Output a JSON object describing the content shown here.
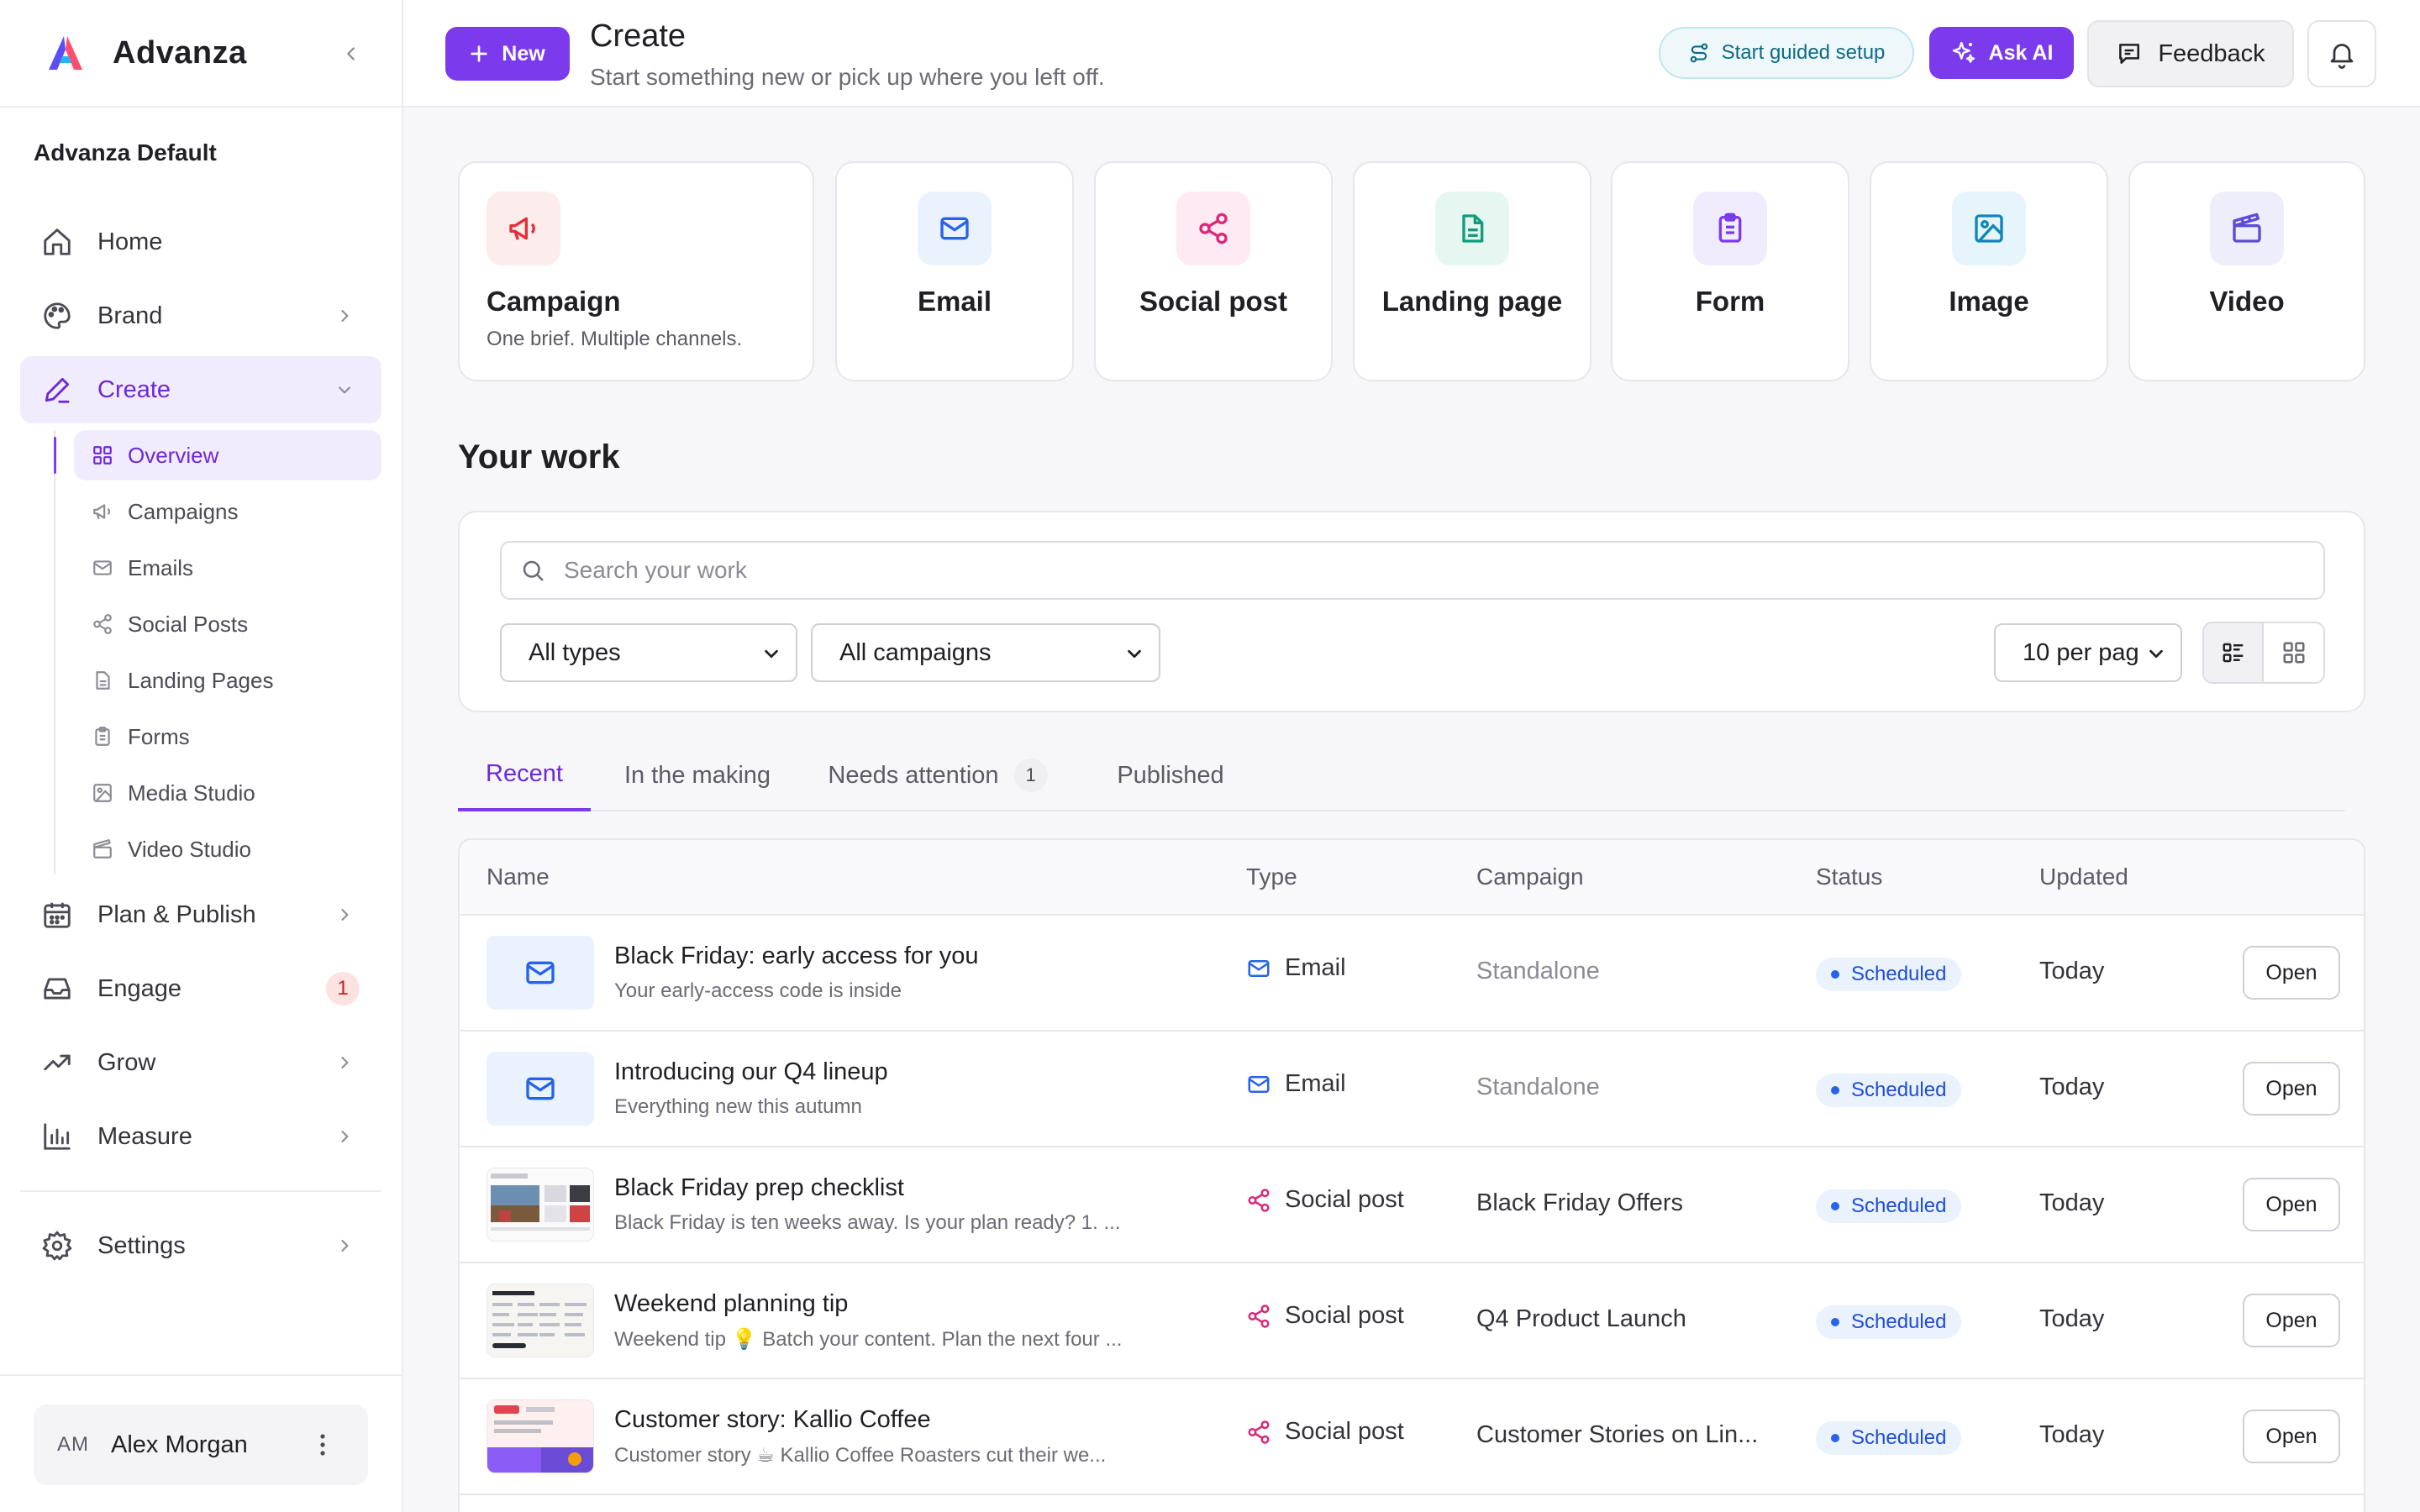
{
  "app": {
    "name": "Advanza",
    "workspace": "Advanza Default"
  },
  "colors": {
    "accent": "#7c3aed",
    "accent_soft": "#f1ecfd",
    "status_scheduled": "#1d4ed8",
    "badge_red": "#c81e1e"
  },
  "sidebar": {
    "items": [
      {
        "label": "Home",
        "icon": "home-icon"
      },
      {
        "label": "Brand",
        "icon": "palette-icon"
      },
      {
        "label": "Create",
        "icon": "pen-icon"
      },
      {
        "label": "Plan & Publish",
        "icon": "calendar-icon"
      },
      {
        "label": "Engage",
        "icon": "inbox-icon",
        "badge": "1"
      },
      {
        "label": "Grow",
        "icon": "trending-up-icon"
      },
      {
        "label": "Measure",
        "icon": "bar-chart-icon"
      },
      {
        "label": "Settings",
        "icon": "gear-icon"
      }
    ],
    "create_sub": [
      {
        "label": "Overview",
        "icon": "grid-icon"
      },
      {
        "label": "Campaigns",
        "icon": "megaphone-icon"
      },
      {
        "label": "Emails",
        "icon": "mail-icon"
      },
      {
        "label": "Social Posts",
        "icon": "share-icon"
      },
      {
        "label": "Landing Pages",
        "icon": "document-icon"
      },
      {
        "label": "Forms",
        "icon": "clipboard-icon"
      },
      {
        "label": "Media Studio",
        "icon": "image-icon"
      },
      {
        "label": "Video Studio",
        "icon": "clapperboard-icon"
      }
    ],
    "user": {
      "initials": "AM",
      "name": "Alex Morgan"
    }
  },
  "header": {
    "new_label": "New",
    "title": "Create",
    "subtitle": "Start something new or pick up where you left off.",
    "guided_label": "Start guided setup",
    "ask_ai_label": "Ask AI",
    "feedback_label": "Feedback"
  },
  "create_cards": {
    "campaign": {
      "label": "Campaign",
      "desc": "One brief. Multiple channels."
    },
    "email": {
      "label": "Email"
    },
    "social": {
      "label": "Social post"
    },
    "landing": {
      "label": "Landing page"
    },
    "form": {
      "label": "Form"
    },
    "image": {
      "label": "Image"
    },
    "video": {
      "label": "Video"
    }
  },
  "your_work": {
    "title": "Your work",
    "search_placeholder": "Search your work",
    "type_filter": "All types",
    "campaign_filter": "All campaigns",
    "per_page": "10 per pag"
  },
  "tabs": [
    {
      "label": "Recent"
    },
    {
      "label": "In the making"
    },
    {
      "label": "Needs attention",
      "count": "1"
    },
    {
      "label": "Published"
    }
  ],
  "table": {
    "headers": {
      "name": "Name",
      "type": "Type",
      "campaign": "Campaign",
      "status": "Status",
      "updated": "Updated"
    },
    "open_label": "Open",
    "rows": [
      {
        "title": "Black Friday: early access for you",
        "sub": "Your early-access code is inside",
        "type": "Email",
        "campaign": "Standalone",
        "status": "Scheduled",
        "updated": "Today"
      },
      {
        "title": "Introducing our Q4 lineup",
        "sub": "Everything new this autumn",
        "type": "Email",
        "campaign": "Standalone",
        "status": "Scheduled",
        "updated": "Today"
      },
      {
        "title": "Black Friday prep checklist",
        "sub": "Black Friday is ten weeks away. Is your plan ready? 1. ...",
        "type": "Social post",
        "campaign": "Black Friday Offers",
        "status": "Scheduled",
        "updated": "Today"
      },
      {
        "title": "Weekend planning tip",
        "sub": "Weekend tip 💡 Batch your content. Plan the next four ...",
        "type": "Social post",
        "campaign": "Q4 Product Launch",
        "status": "Scheduled",
        "updated": "Today"
      },
      {
        "title": "Customer story: Kallio Coffee",
        "sub": "Customer story ☕ Kallio Coffee Roasters cut their we...",
        "type": "Social post",
        "campaign": "Customer Stories on Lin...",
        "status": "Scheduled",
        "updated": "Today"
      }
    ]
  }
}
